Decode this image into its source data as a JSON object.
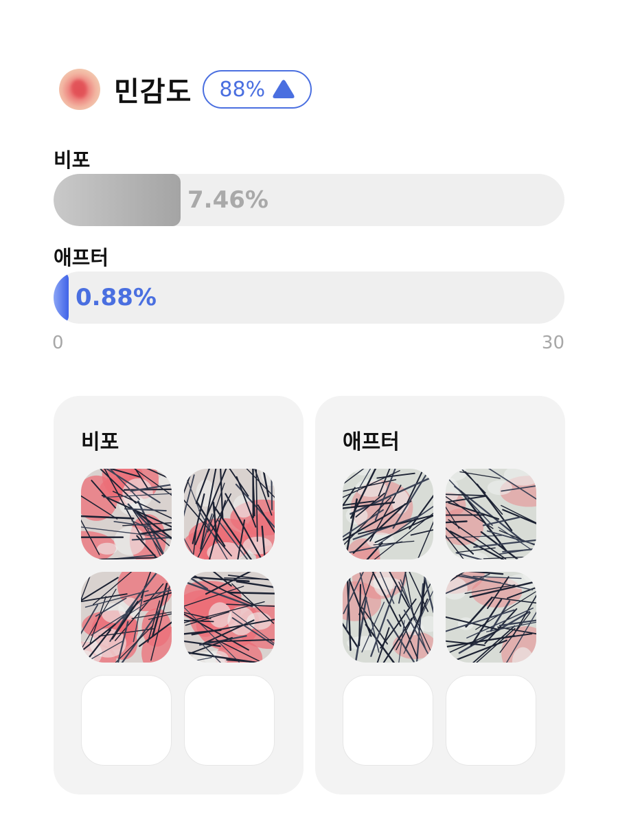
{
  "header": {
    "title": "민감도",
    "badge_value": "88%",
    "badge_icon": "triangle-up-icon",
    "icon": "sensitivity-icon"
  },
  "bars": [
    {
      "label": "비포",
      "value_text": "7.46%",
      "value": 7.46,
      "color": "#a9a9a9"
    },
    {
      "label": "애프터",
      "value_text": "0.88%",
      "value": 0.88,
      "color": "#4a6fe0"
    }
  ],
  "axis": {
    "min": "0",
    "max": "30",
    "min_value": 0,
    "max_value": 30
  },
  "cards": [
    {
      "title": "비포",
      "images": [
        "scalp-before-1",
        "scalp-before-2",
        "scalp-before-3",
        "scalp-before-4"
      ],
      "empty_slots": 2
    },
    {
      "title": "애프터",
      "images": [
        "scalp-after-1",
        "scalp-after-2",
        "scalp-after-3",
        "scalp-after-4"
      ],
      "empty_slots": 2
    }
  ],
  "colors": {
    "accent": "#4a6fe0",
    "track": "#efefef",
    "card_bg": "#f3f3f3",
    "before_gray": "#a9a9a9"
  }
}
